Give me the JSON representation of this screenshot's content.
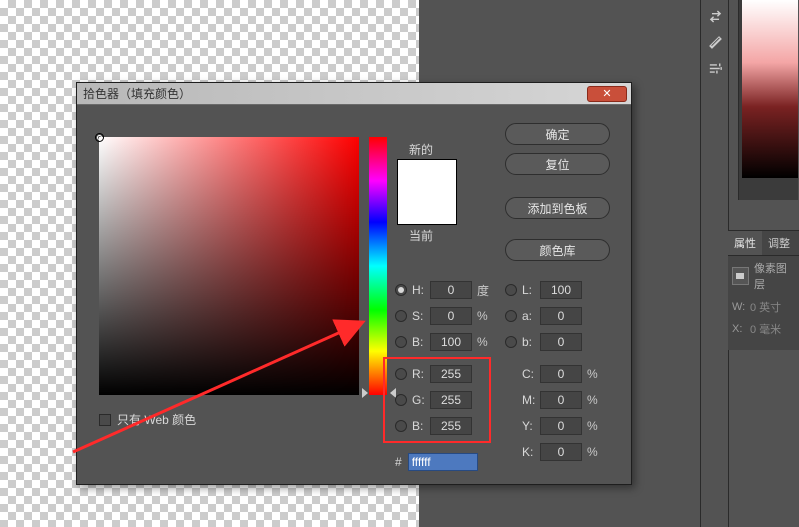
{
  "dialog": {
    "title": "拾色器（填充颜色）",
    "close_glyph": "✕",
    "preview": {
      "new_label": "新的",
      "current_label": "当前"
    },
    "buttons": {
      "ok": "确定",
      "reset": "复位",
      "add_swatch": "添加到色板",
      "color_lib": "颜色库"
    },
    "web_only_label": "只有 Web 颜色",
    "hex_prefix": "#",
    "hex_value": "ffffff",
    "channels": {
      "H": {
        "label": "H:",
        "value": "0",
        "unit": "度",
        "selected": true
      },
      "S": {
        "label": "S:",
        "value": "0",
        "unit": "%"
      },
      "BR": {
        "label": "B:",
        "value": "100",
        "unit": "%"
      },
      "R": {
        "label": "R:",
        "value": "255"
      },
      "G": {
        "label": "G:",
        "value": "255"
      },
      "B": {
        "label": "B:",
        "value": "255"
      },
      "L": {
        "label": "L:",
        "value": "100"
      },
      "a": {
        "label": "a:",
        "value": "0"
      },
      "b": {
        "label": "b:",
        "value": "0"
      },
      "C": {
        "label": "C:",
        "value": "0",
        "unit": "%"
      },
      "M": {
        "label": "M:",
        "value": "0",
        "unit": "%"
      },
      "Y": {
        "label": "Y:",
        "value": "0",
        "unit": "%"
      },
      "K": {
        "label": "K:",
        "value": "0",
        "unit": "%"
      }
    }
  },
  "right_panel": {
    "tabs": {
      "properties": "属性",
      "adjust": "调整"
    },
    "subtitle": "像素图层",
    "rows": {
      "W": {
        "label": "W:",
        "value": "0 英寸"
      },
      "X": {
        "label": "X:",
        "value": "0 毫米"
      }
    }
  }
}
